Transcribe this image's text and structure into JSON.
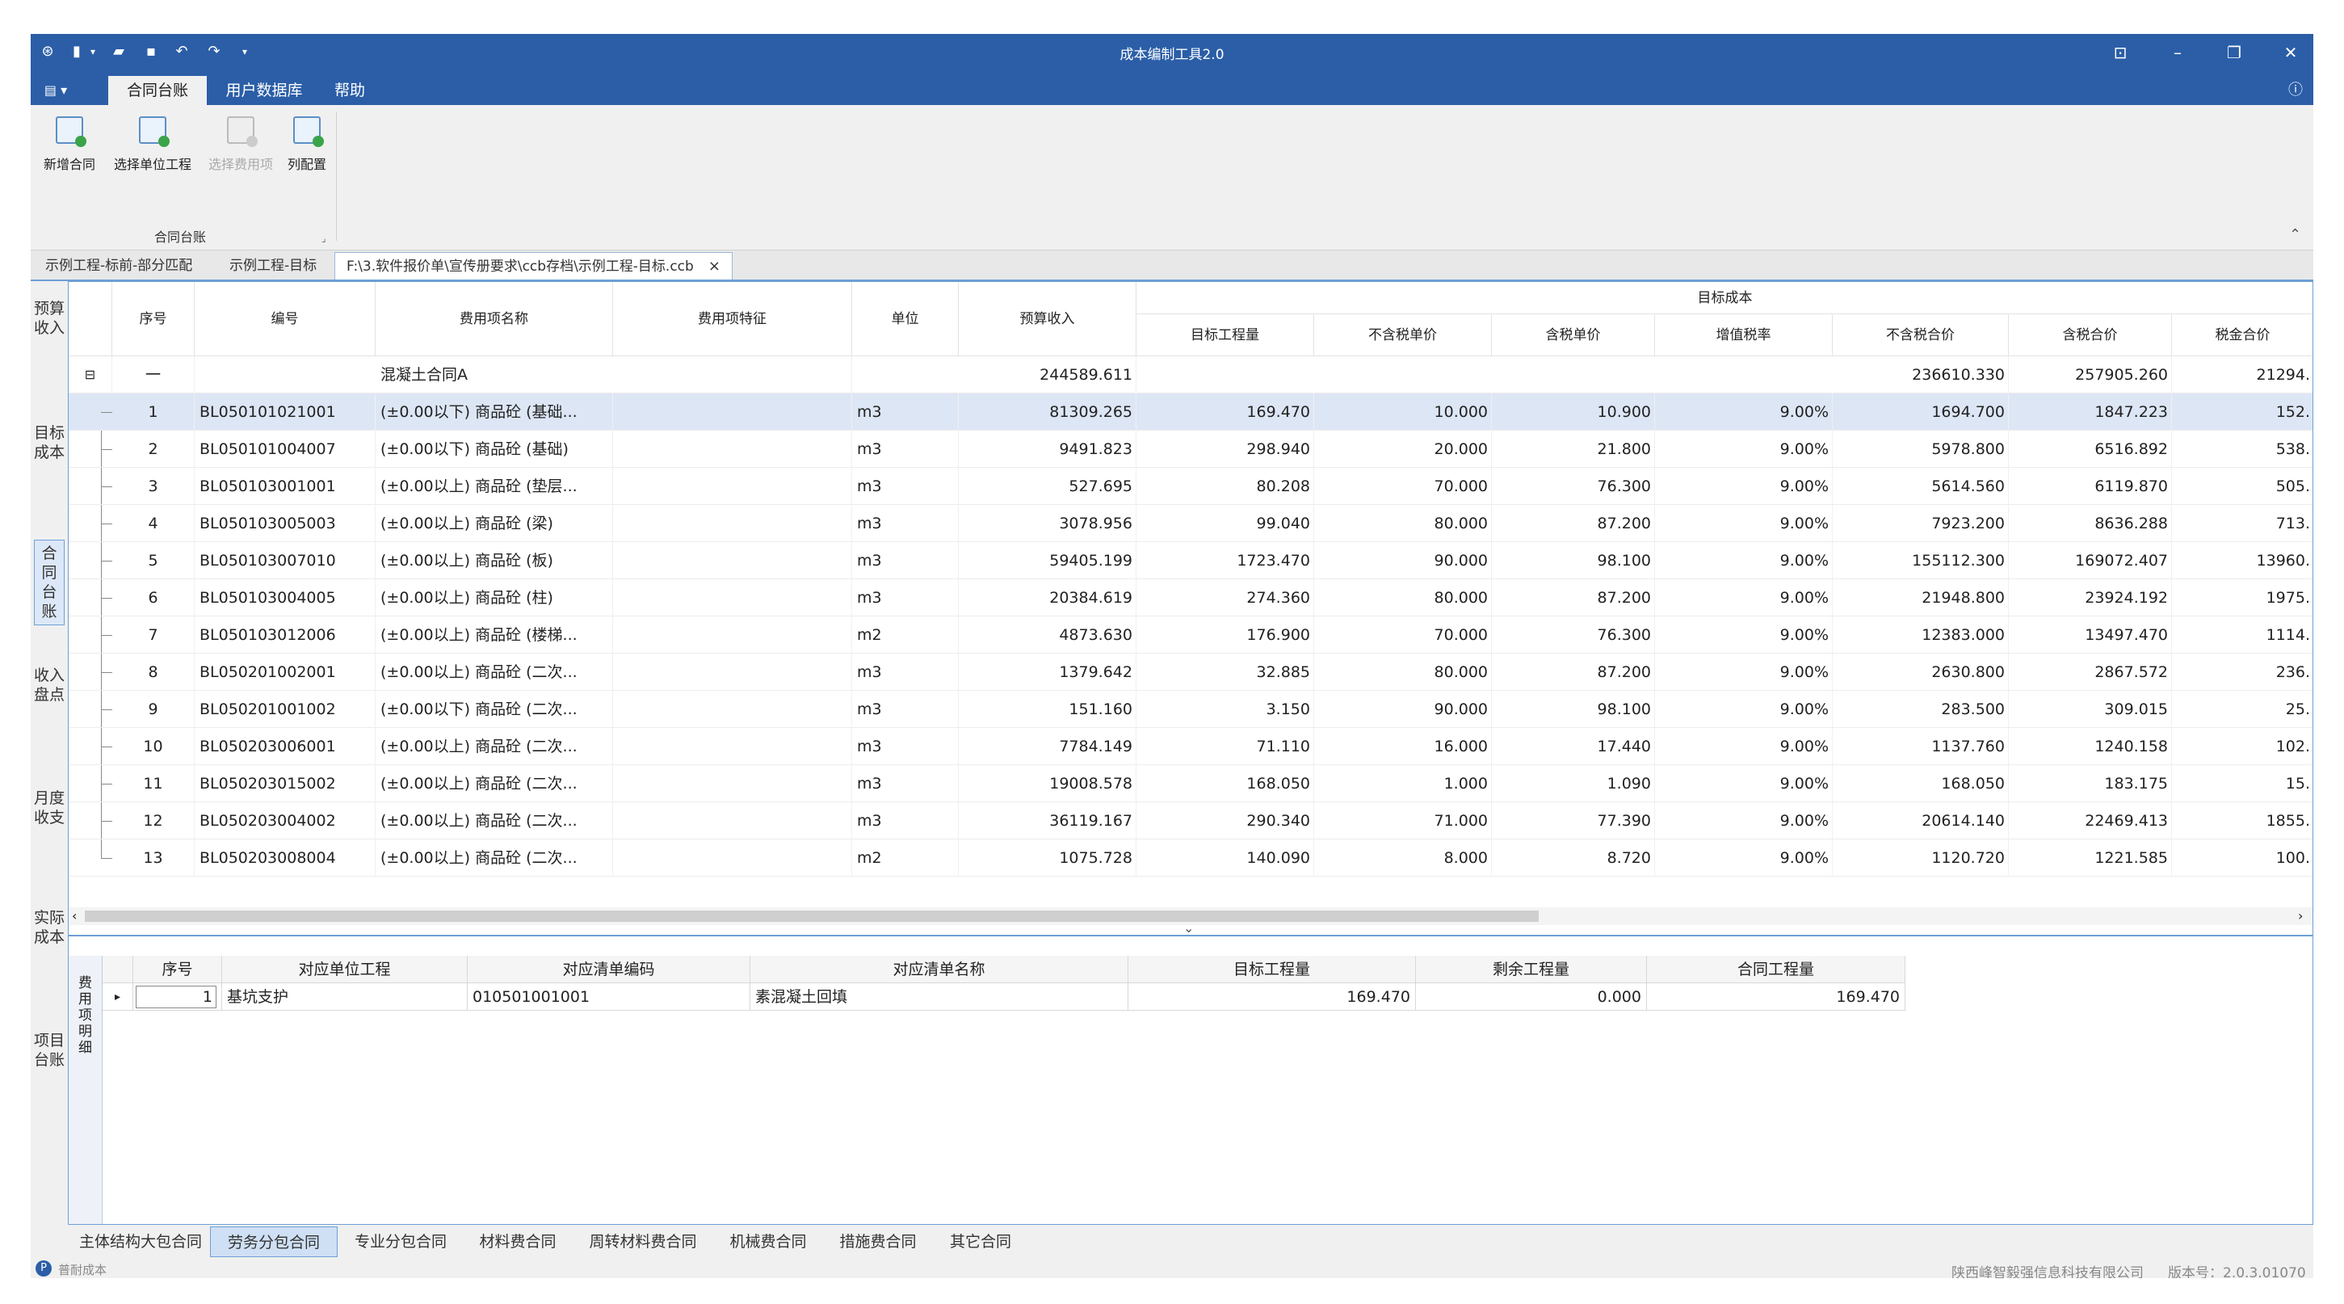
{
  "window": {
    "title": "成本编制工具2.0"
  },
  "menu": {
    "app_button": "▤ ▾",
    "tabs": [
      "合同台账",
      "用户数据库",
      "帮助"
    ]
  },
  "ribbon": {
    "buttons": [
      "新增合同",
      "选择单位工程",
      "选择费用项",
      "列配置"
    ],
    "group_label": "合同台账",
    "collapse_glyph": "⌃"
  },
  "doc_tabs": [
    "示例工程-标前-部分匹配",
    "示例工程-目标",
    "F:\\3.软件报价单\\宣传册要求\\ccb存档\\示例工程-目标.ccb"
  ],
  "doc_tab_close": "×",
  "sidenav": [
    "预算收入",
    "目标成本",
    "合同台账",
    "收入盘点",
    "月度收支",
    "实际成本",
    "项目台账"
  ],
  "grid": {
    "headers": {
      "seq": "序号",
      "code": "编号",
      "name": "费用项名称",
      "feature": "费用项特征",
      "unit": "单位",
      "budget": "预算收入",
      "target_group": "目标成本",
      "qty": "目标工程量",
      "price_ex": "不含税单价",
      "price_in": "含税单价",
      "tax_rate": "增值税率",
      "total_ex": "不含税合价",
      "total_in": "含税合价",
      "tax_total": "税金合价"
    },
    "group_row": {
      "expander": "⊟",
      "seq": "一",
      "name": "混凝土合同A",
      "budget": "244589.611",
      "total_ex": "236610.330",
      "total_in": "257905.260",
      "tax_total": "21294."
    },
    "rows": [
      {
        "seq": "1",
        "code": "BL050101021001",
        "name": "(±0.00以下) 商品砼 (基础...",
        "unit": "m3",
        "budget": "81309.265",
        "qty": "169.470",
        "price_ex": "10.000",
        "price_in": "10.900",
        "tax_rate": "9.00%",
        "total_ex": "1694.700",
        "total_in": "1847.223",
        "tax_total": "152."
      },
      {
        "seq": "2",
        "code": "BL050101004007",
        "name": "(±0.00以下) 商品砼 (基础)",
        "unit": "m3",
        "budget": "9491.823",
        "qty": "298.940",
        "price_ex": "20.000",
        "price_in": "21.800",
        "tax_rate": "9.00%",
        "total_ex": "5978.800",
        "total_in": "6516.892",
        "tax_total": "538."
      },
      {
        "seq": "3",
        "code": "BL050103001001",
        "name": "(±0.00以上) 商品砼 (垫层...",
        "unit": "m3",
        "budget": "527.695",
        "qty": "80.208",
        "price_ex": "70.000",
        "price_in": "76.300",
        "tax_rate": "9.00%",
        "total_ex": "5614.560",
        "total_in": "6119.870",
        "tax_total": "505."
      },
      {
        "seq": "4",
        "code": "BL050103005003",
        "name": "(±0.00以上) 商品砼 (梁)",
        "unit": "m3",
        "budget": "3078.956",
        "qty": "99.040",
        "price_ex": "80.000",
        "price_in": "87.200",
        "tax_rate": "9.00%",
        "total_ex": "7923.200",
        "total_in": "8636.288",
        "tax_total": "713."
      },
      {
        "seq": "5",
        "code": "BL050103007010",
        "name": "(±0.00以上) 商品砼 (板)",
        "unit": "m3",
        "budget": "59405.199",
        "qty": "1723.470",
        "price_ex": "90.000",
        "price_in": "98.100",
        "tax_rate": "9.00%",
        "total_ex": "155112.300",
        "total_in": "169072.407",
        "tax_total": "13960."
      },
      {
        "seq": "6",
        "code": "BL050103004005",
        "name": "(±0.00以上) 商品砼 (柱)",
        "unit": "m3",
        "budget": "20384.619",
        "qty": "274.360",
        "price_ex": "80.000",
        "price_in": "87.200",
        "tax_rate": "9.00%",
        "total_ex": "21948.800",
        "total_in": "23924.192",
        "tax_total": "1975."
      },
      {
        "seq": "7",
        "code": "BL050103012006",
        "name": "(±0.00以上) 商品砼 (楼梯...",
        "unit": "m2",
        "budget": "4873.630",
        "qty": "176.900",
        "price_ex": "70.000",
        "price_in": "76.300",
        "tax_rate": "9.00%",
        "total_ex": "12383.000",
        "total_in": "13497.470",
        "tax_total": "1114."
      },
      {
        "seq": "8",
        "code": "BL050201002001",
        "name": "(±0.00以上) 商品砼 (二次...",
        "unit": "m3",
        "budget": "1379.642",
        "qty": "32.885",
        "price_ex": "80.000",
        "price_in": "87.200",
        "tax_rate": "9.00%",
        "total_ex": "2630.800",
        "total_in": "2867.572",
        "tax_total": "236."
      },
      {
        "seq": "9",
        "code": "BL050201001002",
        "name": "(±0.00以下) 商品砼 (二次...",
        "unit": "m3",
        "budget": "151.160",
        "qty": "3.150",
        "price_ex": "90.000",
        "price_in": "98.100",
        "tax_rate": "9.00%",
        "total_ex": "283.500",
        "total_in": "309.015",
        "tax_total": "25."
      },
      {
        "seq": "10",
        "code": "BL050203006001",
        "name": "(±0.00以上) 商品砼 (二次...",
        "unit": "m3",
        "budget": "7784.149",
        "qty": "71.110",
        "price_ex": "16.000",
        "price_in": "17.440",
        "tax_rate": "9.00%",
        "total_ex": "1137.760",
        "total_in": "1240.158",
        "tax_total": "102."
      },
      {
        "seq": "11",
        "code": "BL050203015002",
        "name": "(±0.00以上) 商品砼 (二次...",
        "unit": "m3",
        "budget": "19008.578",
        "qty": "168.050",
        "price_ex": "1.000",
        "price_in": "1.090",
        "tax_rate": "9.00%",
        "total_ex": "168.050",
        "total_in": "183.175",
        "tax_total": "15."
      },
      {
        "seq": "12",
        "code": "BL050203004002",
        "name": "(±0.00以上) 商品砼 (二次...",
        "unit": "m3",
        "budget": "36119.167",
        "qty": "290.340",
        "price_ex": "71.000",
        "price_in": "77.390",
        "tax_rate": "9.00%",
        "total_ex": "20614.140",
        "total_in": "22469.413",
        "tax_total": "1855."
      },
      {
        "seq": "13",
        "code": "BL050203008004",
        "name": "(±0.00以上) 商品砼 (二次...",
        "unit": "m2",
        "budget": "1075.728",
        "qty": "140.090",
        "price_ex": "8.000",
        "price_in": "8.720",
        "tax_rate": "9.00%",
        "total_ex": "1120.720",
        "total_in": "1221.585",
        "tax_total": "100."
      }
    ],
    "scroll_left": "‹",
    "scroll_right": "›",
    "splitter": "⌄"
  },
  "detail": {
    "vtab": "费用项明细",
    "headers": [
      "序号",
      "对应单位工程",
      "对应清单编码",
      "对应清单名称",
      "目标工程量",
      "剩余工程量",
      "合同工程量"
    ],
    "row": {
      "marker": "▸",
      "seq": "1",
      "unit_project": "基坑支护",
      "bill_code": "010501001001",
      "bill_name": "素混凝土回填",
      "target_qty": "169.470",
      "remain_qty": "0.000",
      "contract_qty": "169.470"
    }
  },
  "bottom_tabs": [
    "主体结构大包合同",
    "劳务分包合同",
    "专业分包合同",
    "材料费合同",
    "周转材料费合同",
    "机械费合同",
    "措施费合同",
    "其它合同"
  ],
  "status": {
    "left": "普耐成本",
    "company": "陕西峰智毅强信息科技有限公司",
    "version": "版本号：2.0.3.01070"
  },
  "colors": {
    "accent": "#2b5ea7",
    "selected_row": "#dde6f5",
    "border": "#6d9fd6"
  }
}
